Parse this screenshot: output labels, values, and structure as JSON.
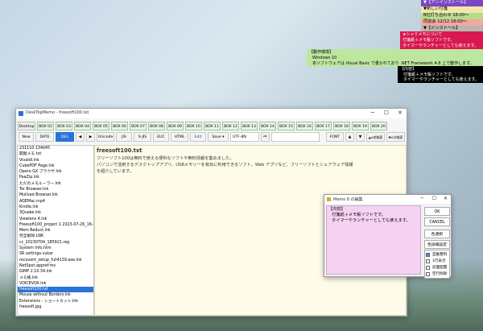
{
  "desktop_memos": {
    "install": "▼【アンインストール】",
    "new_feature": "▼新しい付箋",
    "meeting": "B社打ち合わせ 18:00～",
    "reminder": "同窓会 12/12 18:00～",
    "install2": "▼【インストール】",
    "sticky_title": "★シャミメモについて",
    "sticky_lines": [
      "付箋紙＋メモ帳ソフトです。",
      "タイマーやランチャーとしても使えます。"
    ],
    "env_title": "【動作環境】",
    "env_lines": [
      "Windows 10",
      "本ソフトウェアは Visual Basic で書かれており .NET Framework 4.8 上で動作します。"
    ],
    "content_title": "【内容】",
    "content_lines": [
      "付箋紙＋メモ帳ソフトです。",
      "タイマーやランチャーとしても使えます。"
    ]
  },
  "main_window": {
    "title": "DeskTopMemo - freesoft100.txt",
    "box_tabs": [
      "Desktop",
      "BOX 02",
      "BOX 03",
      "BOX 04",
      "BOX 05",
      "BOX 06",
      "BOX 07",
      "BOX 08",
      "BOX 09",
      "BOX 10",
      "BOX 11",
      "BOX 12",
      "BOX 13",
      "BOX 14",
      "BOX 15",
      "BOX 16",
      "BOX 17",
      "BOX 18",
      "BOX 19",
      "BOX 20"
    ],
    "toolbar": {
      "new": "New",
      "date": "DATE",
      "del": "DEL",
      "prev": "◀",
      "next": "▶",
      "unicode": "Unicode",
      "jis": "JIS",
      "sjis": "S-JIS",
      "euc": "EUC",
      "html": "HTML",
      "edit": "Edit",
      "save": "Save ▾",
      "encoding": "UTF-8N",
      "skip_back": "⏮",
      "font": "FONT",
      "up": "▲",
      "down": "▼",
      "tag_prev": "▲#前検索",
      "tag_next": "▼#次検索"
    },
    "files": [
      "231110 134045",
      "開発メモ.txt",
      "VivaldI.lnk",
      "CubePDF Page.lnk",
      "Opera GX ブラウザ.lnk",
      "PeaZip.lnk",
      "ただのメモルーラー.lnk",
      "Tor Browser.lnk",
      "Mullvad Browser.lnk",
      "AGEMac.mp4",
      "Kindle.lnk",
      "3Quake.lnk",
      "Viewlens 4.lnk",
      "Freesoft100_project 1 2023-07-26_16-38",
      "Mem Reduct.lnk",
      "完全削除.LNK",
      "cc_20230704_185921.reg",
      "System Info.htm",
      "SR settings.vukar",
      "recovent_setup_full4139.exe.lnk",
      "NetSpot.appref-ms",
      "GIMP 2.10.34.lnk",
      "メモ帳.lnk",
      "VOICEVOX.lnk",
      "freesoft100.txt",
      "Mouse without Borders.lnk",
      "Extensions - ショートカット.lnk",
      "freesoft.jpg"
    ],
    "selected_file": "freesoft100.txt",
    "doc_title": "freesoft100.txt",
    "doc_lines": [
      "フリーソフト100は無料で使える便利なソフトや無料情報を集めました。",
      "パソコンで活用するデスクトップアプリ、USBメモリーを有効に利用できるソフト、Web アプリなど、フリーソフトとシェアウェア情報",
      "を紹介しています。"
    ]
  },
  "dialog": {
    "title": "Memo 8 の編集",
    "heading": "【内容】",
    "lines": [
      "付箋紙＋メモ帳ソフトです。",
      "タイマーやランチャーとしても使えます。"
    ],
    "ok": "OK",
    "cancel": "CANCEL",
    "color": "色選択",
    "detail": "色詳細設定",
    "checks": [
      {
        "label": "自動整列",
        "checked": true
      },
      {
        "label": "1行表示",
        "checked": false
      },
      {
        "label": "前面配置",
        "checked": false
      },
      {
        "label": "空行削除",
        "checked": false
      }
    ]
  }
}
